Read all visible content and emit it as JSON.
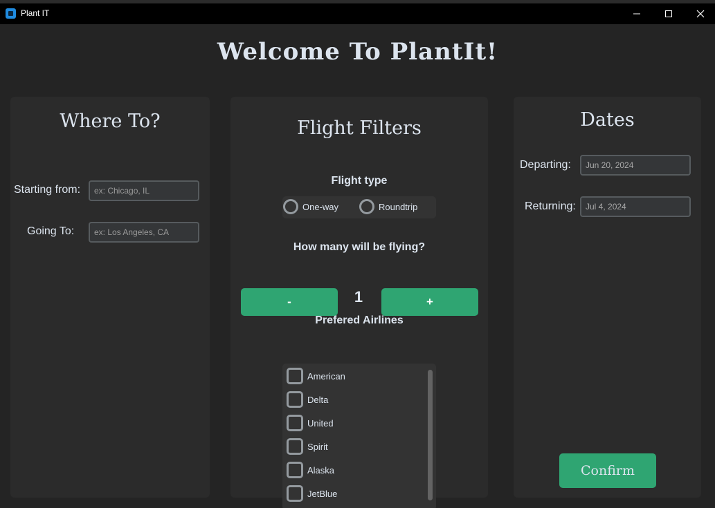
{
  "window": {
    "title": "Plant IT"
  },
  "header": {
    "welcome": "Welcome To PlantIt!"
  },
  "where": {
    "title": "Where To?",
    "starting_label": "Starting from:",
    "starting_placeholder": "ex: Chicago, IL",
    "going_label": "Going To:",
    "going_placeholder": "ex: Los Angeles, CA"
  },
  "filters": {
    "title": "Flight Filters",
    "flight_type_label": "Flight type",
    "flight_type_options": [
      "One-way",
      "Roundtrip"
    ],
    "passengers_label": "How many will be flying?",
    "minus_label": "-",
    "plus_label": "+",
    "passenger_count": "1",
    "airlines_label": "Prefered Airlines",
    "airlines": [
      "American",
      "Delta",
      "United",
      "Spirit",
      "Alaska",
      "JetBlue"
    ]
  },
  "dates": {
    "title": "Dates",
    "departing_label": "Departing:",
    "departing_value": "Jun 20, 2024",
    "returning_label": "Returning:",
    "returning_value": "Jul 4, 2024",
    "confirm_label": "Confirm"
  },
  "colors": {
    "accent": "#2fa572",
    "panel": "#2b2b2b",
    "background": "#242424"
  }
}
